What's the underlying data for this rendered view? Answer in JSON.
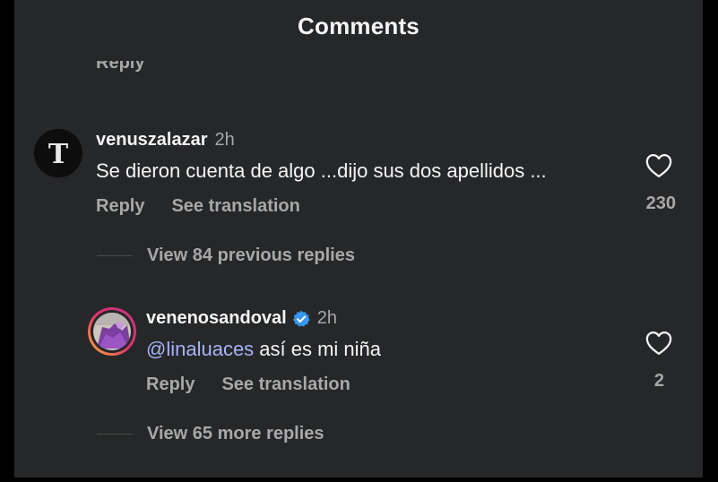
{
  "header": {
    "title": "Comments"
  },
  "partial_reply_label": "Reply",
  "comments": [
    {
      "username": "venuszalazar",
      "time": "2h",
      "text": "Se dieron cuenta de algo ...dijo sus dos apellidos ...",
      "reply_label": "Reply",
      "translation_label": "See translation",
      "like_count": "230",
      "avatar_letter": "T",
      "view_replies": "View 84 previous replies"
    },
    {
      "username": "venenosandoval",
      "verified": true,
      "time": "2h",
      "mention": "@linaluaces",
      "text": " así es mi niña",
      "reply_label": "Reply",
      "translation_label": "See translation",
      "like_count": "2",
      "view_replies": "View 65 more replies"
    }
  ],
  "colors": {
    "background": "#262729",
    "text": "#f5f5f5",
    "secondary": "#a8a8a8",
    "mention": "#a7b4f8",
    "verified": "#3897f0"
  }
}
